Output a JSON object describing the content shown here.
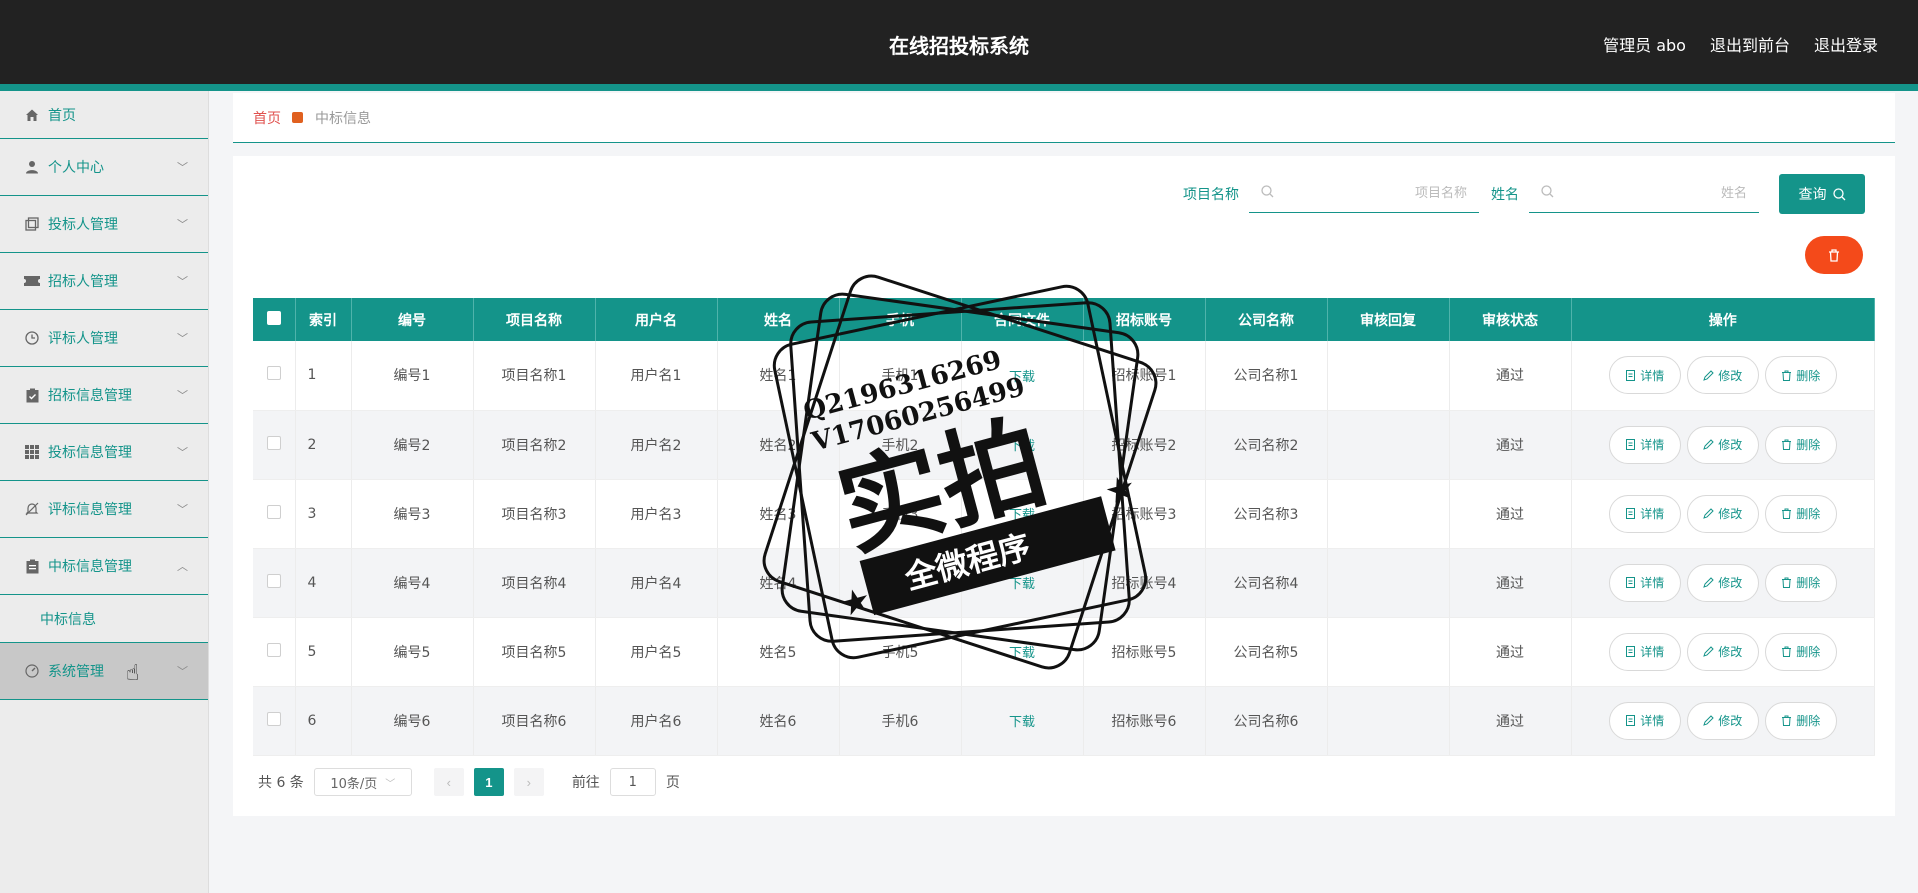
{
  "header": {
    "title": "在线招投标系统",
    "user": "管理员 abo",
    "to_front": "退出到前台",
    "logout": "退出登录"
  },
  "sidebar": {
    "items": [
      {
        "label": "首页",
        "icon": "home-icon"
      },
      {
        "label": "个人中心",
        "icon": "user-icon"
      },
      {
        "label": "投标人管理",
        "icon": "copy-icon"
      },
      {
        "label": "招标人管理",
        "icon": "ticket-icon"
      },
      {
        "label": "评标人管理",
        "icon": "clock-icon"
      },
      {
        "label": "招标信息管理",
        "icon": "clipboard-check-icon"
      },
      {
        "label": "投标信息管理",
        "icon": "grid-icon"
      },
      {
        "label": "评标信息管理",
        "icon": "bell-off-icon"
      },
      {
        "label": "中标信息管理",
        "icon": "clipboard-icon"
      },
      {
        "label": "系统管理",
        "icon": "gauge-icon"
      }
    ],
    "sub_item": "中标信息"
  },
  "breadcrumb": {
    "home": "首页",
    "current": "中标信息"
  },
  "search": {
    "project_label": "项目名称",
    "project_placeholder": "项目名称",
    "name_label": "姓名",
    "name_placeholder": "姓名",
    "query_label": "查询"
  },
  "table": {
    "headers": [
      "索引",
      "编号",
      "项目名称",
      "用户名",
      "姓名",
      "手机",
      "合同文件",
      "招标账号",
      "公司名称",
      "审核回复",
      "审核状态",
      "操作"
    ],
    "rows": [
      {
        "index": "1",
        "code": "编号1",
        "project": "项目名称1",
        "username": "用户名1",
        "name": "姓名1",
        "phone": "手机1",
        "file": "下载",
        "account": "招标账号1",
        "company": "公司名称1",
        "reply": "",
        "status": "通过"
      },
      {
        "index": "2",
        "code": "编号2",
        "project": "项目名称2",
        "username": "用户名2",
        "name": "姓名2",
        "phone": "手机2",
        "file": "下载",
        "account": "招标账号2",
        "company": "公司名称2",
        "reply": "",
        "status": "通过"
      },
      {
        "index": "3",
        "code": "编号3",
        "project": "项目名称3",
        "username": "用户名3",
        "name": "姓名3",
        "phone": "手机3",
        "file": "下载",
        "account": "招标账号3",
        "company": "公司名称3",
        "reply": "",
        "status": "通过"
      },
      {
        "index": "4",
        "code": "编号4",
        "project": "项目名称4",
        "username": "用户名4",
        "name": "姓名4",
        "phone": "手机4",
        "file": "下载",
        "account": "招标账号4",
        "company": "公司名称4",
        "reply": "",
        "status": "通过"
      },
      {
        "index": "5",
        "code": "编号5",
        "project": "项目名称5",
        "username": "用户名5",
        "name": "姓名5",
        "phone": "手机5",
        "file": "下载",
        "account": "招标账号5",
        "company": "公司名称5",
        "reply": "",
        "status": "通过"
      },
      {
        "index": "6",
        "code": "编号6",
        "project": "项目名称6",
        "username": "用户名6",
        "name": "姓名6",
        "phone": "手机6",
        "file": "下载",
        "account": "招标账号6",
        "company": "公司名称6",
        "reply": "",
        "status": "通过"
      }
    ],
    "ops": {
      "detail": "详情",
      "edit": "修改",
      "delete": "删除"
    }
  },
  "pagination": {
    "total": "共 6 条",
    "page_size": "10条/页",
    "current_page": "1",
    "goto_prefix": "前往",
    "goto_value": "1",
    "goto_suffix": "页"
  },
  "watermark": {
    "line1": "Q2196316269",
    "line2": "V17060256499",
    "main": "实拍",
    "banner": "全微程序"
  },
  "colors": {
    "topbar": "#222222",
    "accent": "#14948a",
    "delete": "#f44a1a",
    "breadcrumb_home": "#e0524f"
  }
}
